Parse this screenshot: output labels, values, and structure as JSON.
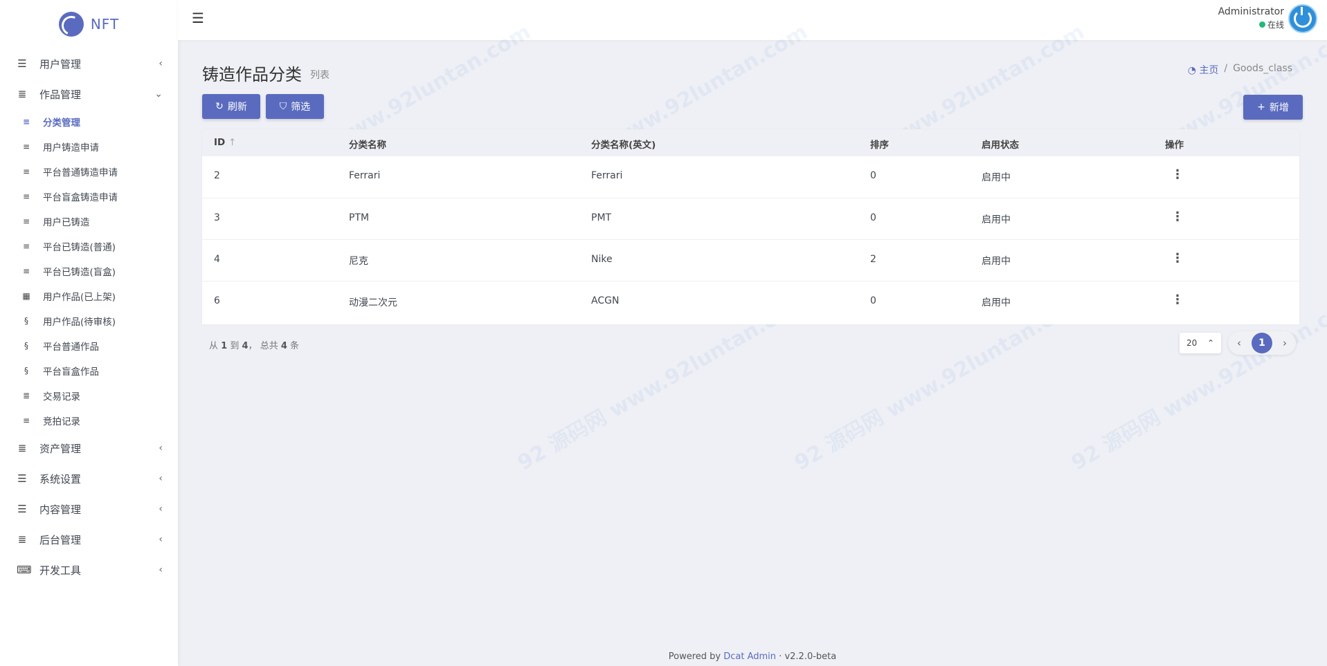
{
  "brand": {
    "name": "NFT"
  },
  "sidebar": {
    "groups_top": [
      {
        "label": "用户管理",
        "icon": "bars-icon",
        "chevron": "‹"
      },
      {
        "label": "作品管理",
        "icon": "list-icon",
        "chevron": "⌄"
      }
    ],
    "sub_items": [
      {
        "label": "分类管理",
        "icon": "align-left-icon",
        "active": true
      },
      {
        "label": "用户铸造申请",
        "icon": "align-left-icon"
      },
      {
        "label": "平台普通铸造申请",
        "icon": "align-left-icon"
      },
      {
        "label": "平台盲盒铸造申请",
        "icon": "align-left-icon"
      },
      {
        "label": "用户已铸造",
        "icon": "align-left-icon"
      },
      {
        "label": "平台已铸造(普通)",
        "icon": "align-left-icon"
      },
      {
        "label": "平台已铸造(盲盒)",
        "icon": "align-left-icon"
      },
      {
        "label": "用户作品(已上架)",
        "icon": "grid-icon"
      },
      {
        "label": "用户作品(待审核)",
        "icon": "fingerprint-icon"
      },
      {
        "label": "平台普通作品",
        "icon": "fingerprint-icon"
      },
      {
        "label": "平台盲盒作品",
        "icon": "fingerprint-icon"
      },
      {
        "label": "交易记录",
        "icon": "list-icon"
      },
      {
        "label": "竞拍记录",
        "icon": "align-left-icon"
      }
    ],
    "groups_bottom": [
      {
        "label": "资产管理",
        "icon": "list-icon",
        "chevron": "‹"
      },
      {
        "label": "系统设置",
        "icon": "bars-icon",
        "chevron": "‹"
      },
      {
        "label": "内容管理",
        "icon": "bars-icon",
        "chevron": "‹"
      },
      {
        "label": "后台管理",
        "icon": "list-icon",
        "chevron": "‹"
      },
      {
        "label": "开发工具",
        "icon": "keyboard-icon",
        "chevron": "‹"
      }
    ]
  },
  "header": {
    "user_name": "Administrator",
    "user_status": "在线"
  },
  "page": {
    "title": "铸造作品分类",
    "subtitle": "列表"
  },
  "breadcrumb": {
    "home": "主页",
    "separator": "/",
    "current": "Goods_class"
  },
  "toolbar": {
    "refresh": "刷新",
    "filter": "筛选",
    "create": "新增"
  },
  "table": {
    "columns": [
      "ID",
      "分类名称",
      "分类名称(英文)",
      "排序",
      "启用状态",
      "操作"
    ],
    "rows": [
      {
        "id": "2",
        "name": "Ferrari",
        "name_en": "Ferrari",
        "order": "0",
        "status": "启用中"
      },
      {
        "id": "3",
        "name": "PTM",
        "name_en": "PMT",
        "order": "0",
        "status": "启用中"
      },
      {
        "id": "4",
        "name": "尼克",
        "name_en": "Nike",
        "order": "2",
        "status": "启用中"
      },
      {
        "id": "6",
        "name": "动漫二次元",
        "name_en": "ACGN",
        "order": "0",
        "status": "启用中"
      }
    ]
  },
  "pagination": {
    "from_label": "从",
    "from": "1",
    "to_label": "到",
    "to": "4",
    "total_label": "总共",
    "total": "4",
    "unit": "条",
    "per_page": "20",
    "current_page": "1"
  },
  "footer": {
    "powered_by": "Powered by",
    "link": "Dcat Admin",
    "version": "v2.2.0-beta"
  },
  "colors": {
    "primary": "#5a6bbf",
    "background": "#eff0f5",
    "status_online": "#21b978"
  }
}
